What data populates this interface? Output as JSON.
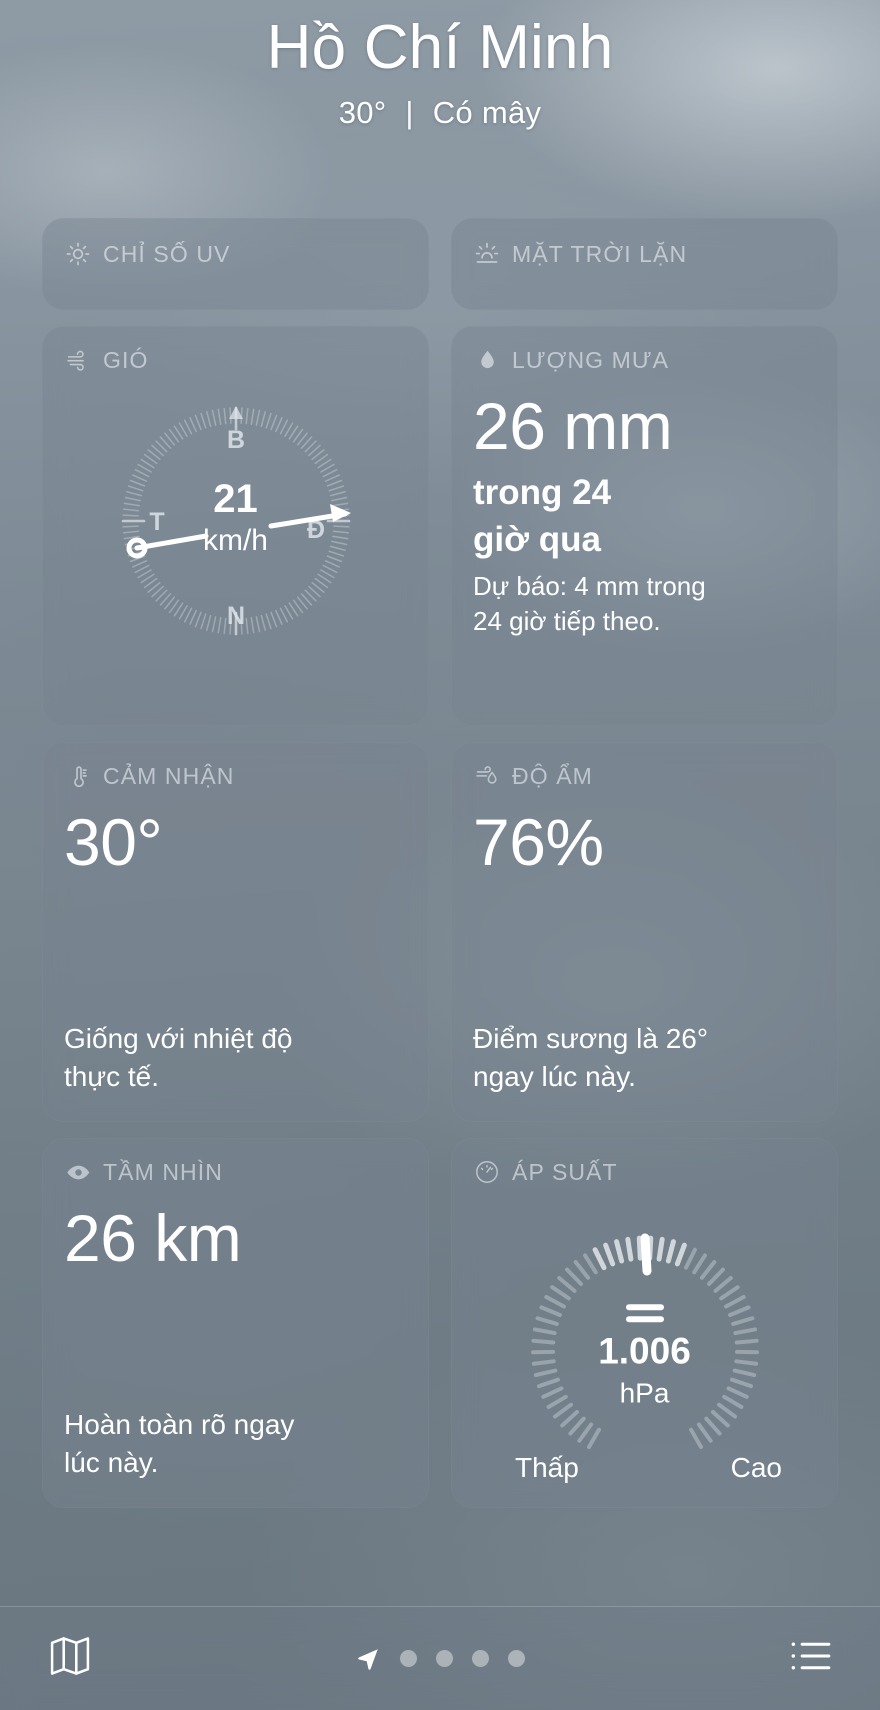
{
  "header": {
    "city": "Hồ Chí Minh",
    "temperature": "30°",
    "separator": "|",
    "condition": "Có mây"
  },
  "cards": {
    "uv": {
      "title": "CHỈ SỐ UV",
      "icon": "sun-icon"
    },
    "sunset": {
      "title": "MẶT TRỜI LẶN",
      "icon": "sunset-icon"
    },
    "wind": {
      "title": "GIÓ",
      "icon": "wind-icon",
      "speed": "21",
      "unit": "km/h",
      "compass": {
        "north": "B",
        "east": "Đ",
        "south": "N",
        "west": "T"
      }
    },
    "precipitation": {
      "title": "LƯỢNG MƯA",
      "icon": "droplet-icon",
      "value": "26 mm",
      "period_line1": "trong 24",
      "period_line2": "giờ qua",
      "forecast_line1": "Dự báo: 4 mm trong",
      "forecast_line2": "24 giờ tiếp theo."
    },
    "feels_like": {
      "title": "CẢM NHẬN",
      "icon": "thermometer-icon",
      "value": "30°",
      "note_line1": "Giống với nhiệt độ",
      "note_line2": "thực tế."
    },
    "humidity": {
      "title": "ĐỘ ẨM",
      "icon": "humidity-icon",
      "value": "76%",
      "note_line1": "Điểm sương là 26°",
      "note_line2": "ngay lúc này."
    },
    "visibility": {
      "title": "TẦM NHÌN",
      "icon": "eye-icon",
      "value": "26 km",
      "note_line1": "Hoàn toàn rõ ngay",
      "note_line2": "lúc này."
    },
    "pressure": {
      "title": "ÁP SUẤT",
      "icon": "gauge-icon",
      "trend_symbol": "=",
      "value": "1.006",
      "unit": "hPa",
      "low_label": "Thấp",
      "high_label": "Cao"
    }
  },
  "tabbar": {
    "map_icon": "map-icon",
    "location_icon": "location-arrow-icon",
    "list_icon": "list-icon",
    "page_count": 4
  },
  "colors": {
    "card_bg": "#76838f",
    "text_primary": "#ffffff",
    "text_muted": "#e9eef2"
  }
}
